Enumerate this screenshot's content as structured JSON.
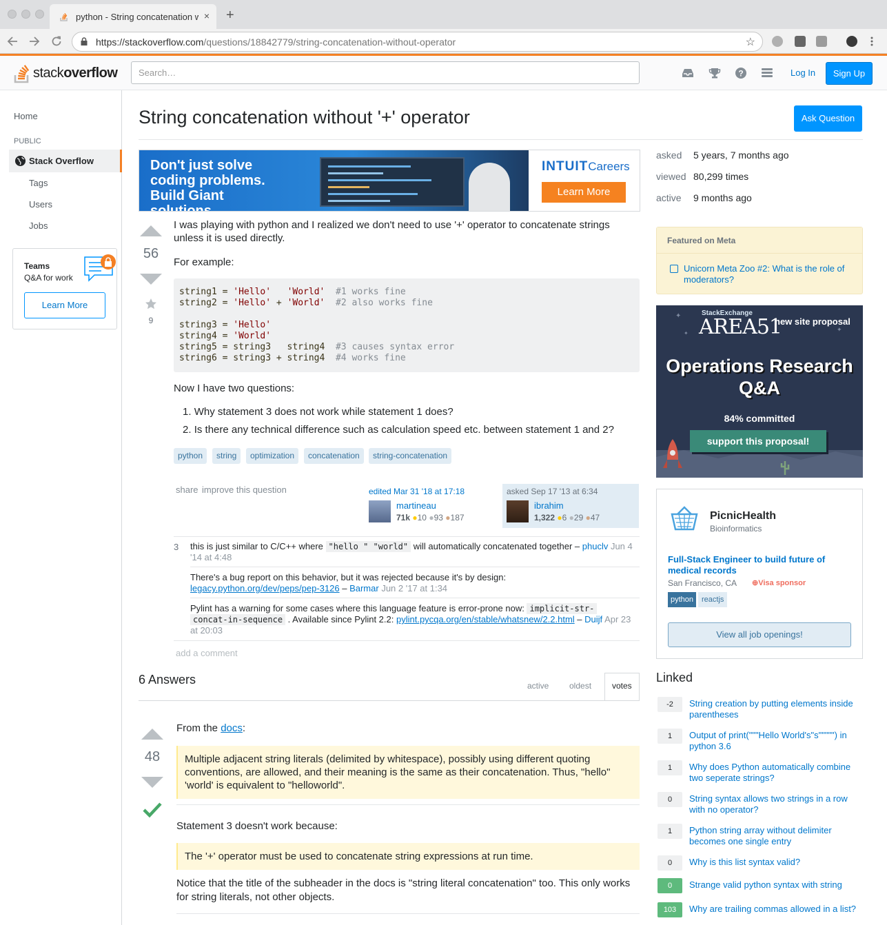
{
  "browser": {
    "tab_title": "python - String concatenation without '+' operator - Stack Overflow",
    "close": "×",
    "new_tab": "+",
    "url_host": "https://stackoverflow.com",
    "url_path": "/questions/18842779/string-concatenation-without-operator"
  },
  "header": {
    "logo_a": "stack",
    "logo_b": "overflow",
    "search_placeholder": "Search…",
    "login": "Log In",
    "signup": "Sign Up"
  },
  "leftnav": {
    "home": "Home",
    "public": "PUBLIC",
    "stackoverflow": "Stack Overflow",
    "tags": "Tags",
    "users": "Users",
    "jobs": "Jobs",
    "teams_title": "Teams",
    "teams_sub": "Q&A for work",
    "teams_btn": "Learn More"
  },
  "question": {
    "title": "String concatenation without '+' operator",
    "ask_button": "Ask Question",
    "votes": "56",
    "favorites": "9",
    "body_p1": "I was playing with python and I realized we don't need to use '+' operator to concatenate strings unless it is used directly.",
    "body_p2": "For example:",
    "body_p3": "Now I have two questions:",
    "list1": "Why statement 3 does not work while statement 1 does?",
    "list2": "Is there any technical difference such as calculation speed etc. between statement 1 and 2?",
    "tags": [
      "python",
      "string",
      "optimization",
      "concatenation",
      "string-concatenation"
    ],
    "share": "share",
    "improve": "improve this question",
    "edited_label": "edited Mar 31 '18 at 17:18",
    "editor_name": "martineau",
    "editor_rep": "71k",
    "editor_gold": "10",
    "editor_silver": "93",
    "editor_bronze": "187",
    "asked_label": "asked Sep 17 '13 at 6:34",
    "asker_name": "ibrahim",
    "asker_rep": "1,322",
    "asker_gold": "6",
    "asker_silver": "29",
    "asker_bronze": "47"
  },
  "code_lines": [
    "string1 = 'Hello'   'World'  #1 works fine",
    "string2 = 'Hello' + 'World'  #2 also works fine",
    "",
    "string3 = 'Hello'",
    "string4 = 'World'",
    "string5 = string3   string4  #3 causes syntax error",
    "string6 = string3 + string4  #4 works fine"
  ],
  "stats": {
    "asked_l": "asked",
    "asked_v": "5 years, 7 months ago",
    "viewed_l": "viewed",
    "viewed_v": "80,299 times",
    "active_l": "active",
    "active_v": "9 months ago"
  },
  "comments": {
    "c1_score": "3",
    "c1_text_a": "this is just similar to C/C++ where",
    "c1_code": "\"hello \" \"world\"",
    "c1_text_b": "will automatically concatenated together –",
    "c1_user": "phuclv",
    "c1_date": "Jun 4 '14 at 4:48",
    "c2_text": "There's a bug report on this behavior, but it was rejected because it's by design:",
    "c2_link": "legacy.python.org/dev/peps/pep-3126",
    "c2_user": "Barmar",
    "c2_date": "Jun 2 '17 at 1:34",
    "c3_text": "Pylint has a warning for some cases where this language feature is error-prone now:",
    "c3_code_a": "implicit-str-",
    "c3_code_b": "concat-in-sequence",
    "c3_text_b": ". Available since Pylint 2.2:",
    "c3_link": "pylint.pycqa.org/en/stable/whatsnew/2.2.html",
    "c3_user": "Duijf",
    "c3_date_a": "Apr 23",
    "c3_date_b": "at 20:03",
    "add": "add a comment"
  },
  "answers": {
    "count": "6 Answers",
    "tab_active": "active",
    "tab_oldest": "oldest",
    "tab_votes": "votes",
    "a1_votes": "48",
    "a1_from": "From the",
    "a1_docs": "docs",
    "a1_colon": ":",
    "a1_quote": "Multiple adjacent string literals (delimited by whitespace), possibly using different quoting conventions, are allowed, and their meaning is the same as their concatenation. Thus, \"hello\" 'world' is equivalent to \"helloworld\".",
    "a1_s3": "Statement 3 doesn't work because:",
    "a1_quote2": "The '+' operator must be used to concatenate string expressions at run time.",
    "a1_notice": "Notice that the title of the subheader in the docs is \"string literal concatenation\" too. This only works for string literals, not other objects."
  },
  "ad": {
    "headline": "Don't just solve coding problems. Build Giant solutions.",
    "brand": "INTUIT",
    "brand_sub": "Careers",
    "button": "Learn More"
  },
  "meta": {
    "header": "Featured on Meta",
    "item": "Unicorn Meta Zoo #2: What is the role of moderators?"
  },
  "area51": {
    "se": "StackExchange",
    "logo": "AREA51",
    "new_site": "new site proposal",
    "title": "Operations Research Q&A",
    "committed": "84% committed",
    "support": "support this proposal!"
  },
  "job": {
    "company": "PicnicHealth",
    "domain": "Bioinformatics",
    "title": "Full-Stack Engineer to build future of medical records",
    "location": "San Francisco, CA",
    "visa": "Visa sponsor",
    "tag1": "python",
    "tag2": "reactjs",
    "button": "View all job openings!"
  },
  "linked": {
    "header": "Linked",
    "items": [
      {
        "score": "-2",
        "title": "String creation by putting elements inside parentheses"
      },
      {
        "score": "1",
        "title": "Output of print(\"\"\"Hello World's\"s\"\"\"\"\") in python 3.6"
      },
      {
        "score": "1",
        "title": "Why does Python automatically combine two seperate strings?"
      },
      {
        "score": "0",
        "title": "String syntax allows two strings in a row with no operator?"
      },
      {
        "score": "1",
        "title": "Python string array without delimiter becomes one single entry"
      },
      {
        "score": "0",
        "title": "Why is this list syntax valid?"
      },
      {
        "score": "0",
        "title": "Strange valid python syntax with string"
      },
      {
        "score": "103",
        "title": "Why are trailing commas allowed in a list?"
      }
    ]
  },
  "colors": {
    "accent": "#f48024",
    "link": "#0077cc",
    "button": "#0095ff",
    "accepted": "#48a868"
  }
}
